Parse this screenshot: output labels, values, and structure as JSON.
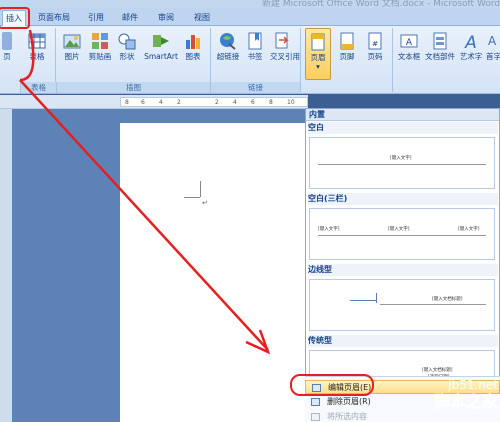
{
  "window": {
    "title": "新建 Microsoft Office Word 文档.docx - Microsoft Word"
  },
  "tabs": [
    {
      "label": "插入",
      "active": true
    },
    {
      "label": "页面布局",
      "active": false
    },
    {
      "label": "引用",
      "active": false
    },
    {
      "label": "邮件",
      "active": false
    },
    {
      "label": "审阅",
      "active": false
    },
    {
      "label": "视图",
      "active": false
    }
  ],
  "ribbon": {
    "buttons": {
      "page": "页",
      "table": "表格",
      "picture": "图片",
      "clipart": "剪贴画",
      "shapes": "形状",
      "smartart": "SmartArt",
      "chart": "图表",
      "hyperlink": "超链接",
      "bookmark": "书签",
      "crossref": "交叉引用",
      "header": "页眉",
      "footer": "页脚",
      "pagenum": "页码",
      "textbox": "文本框",
      "quickparts": "文档部件",
      "wordart": "艺术字",
      "dropcap": "首字"
    },
    "groups": {
      "tables": "表格",
      "illustrations": "插图",
      "links": "链接"
    }
  },
  "ruler": {
    "ticks": [
      "8",
      "6",
      "4",
      "2",
      "2",
      "4",
      "6",
      "8",
      "10"
    ]
  },
  "gallery": {
    "heading": "内置",
    "sections": [
      {
        "title": "空白",
        "texts": [
          "[键入文字]"
        ]
      },
      {
        "title": "空白(三栏)",
        "texts": [
          "[键入文字]",
          "[键入文字]",
          "[键入文字]"
        ]
      },
      {
        "title": "边线型",
        "texts": [
          "[键入文档标题]"
        ]
      },
      {
        "title": "传统型",
        "texts": [
          "[键入文档标题]",
          "[选取日期]"
        ]
      }
    ]
  },
  "menu": {
    "edit_header": "编辑页眉(E)",
    "remove_header": "删除页眉(R)",
    "save_selection": "将所选内容"
  },
  "watermark": {
    "url": "jb51.net",
    "name": "脚本之家"
  },
  "colors": {
    "annotation": "#e52020",
    "ribbon": "#d3e3f6",
    "highlight": "#ffe08a"
  }
}
